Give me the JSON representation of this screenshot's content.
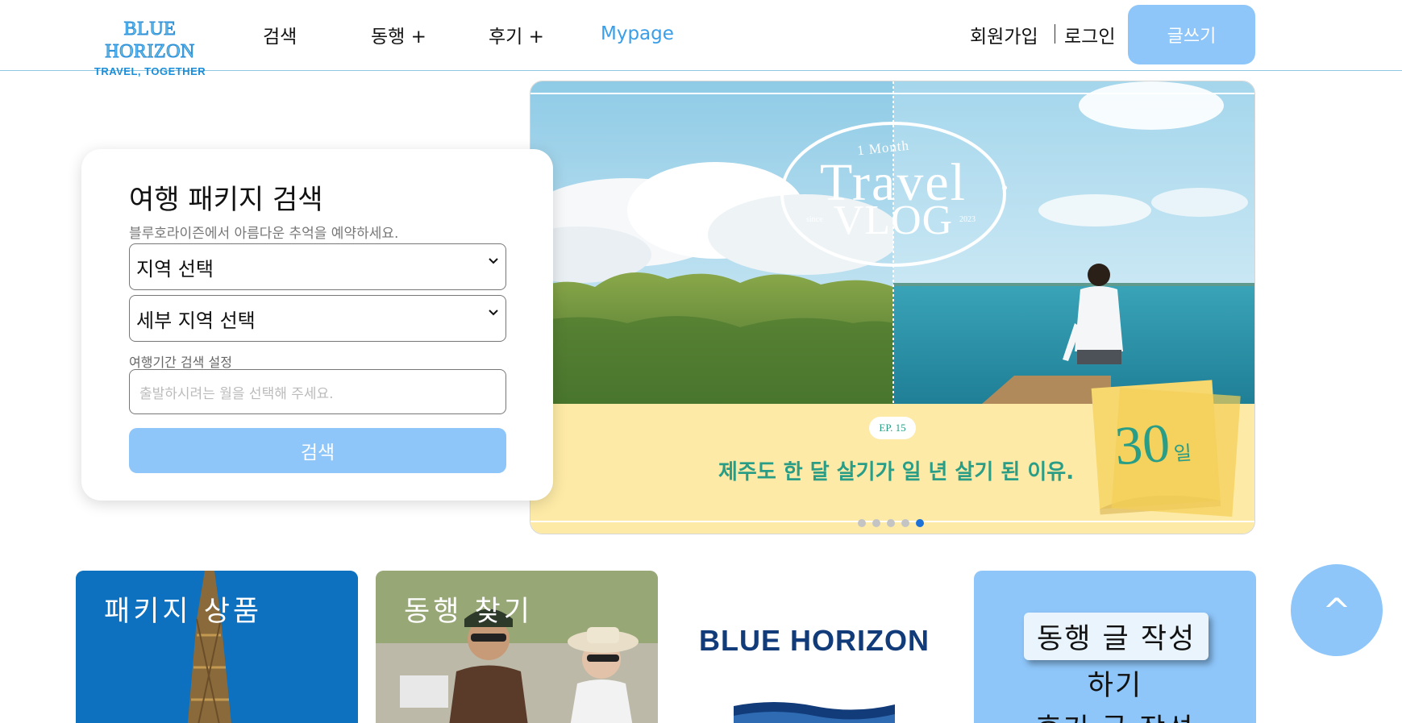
{
  "header": {
    "logo_main": "BLUE HORIZON",
    "logo_sub": "TRAVEL, TOGETHER",
    "nav": [
      {
        "label": "검색"
      },
      {
        "label": "동행 +"
      },
      {
        "label": "후기 +"
      },
      {
        "label": "Mypage"
      }
    ],
    "signup": "회원가입",
    "login": "로그인",
    "write_button": "글쓰기"
  },
  "search": {
    "title": "여행 패키지 검색",
    "subtitle": "블루호라이즌에서 아름다운 추억을 예약하세요.",
    "region_select": "지역 선택",
    "subregion_select": "세부 지역 선택",
    "period_label": "여행기간 검색 설정",
    "date_placeholder": "출발하시려는 월을 선택해 주세요.",
    "search_button": "검색"
  },
  "banner": {
    "small_title": "1 Month",
    "title_line1": "Travel",
    "title_line2": "VLOG",
    "since": "since",
    "year": "2023",
    "episode": "EP. 15",
    "caption": "제주도 한 달 살기가 일 년 살기 된 이유.",
    "days": "30",
    "days_unit": "일",
    "slide_count": 5,
    "active_slide": 5,
    "accent_color": "#2a9d86",
    "banner_bg": "#fdeaa6"
  },
  "tiles": {
    "package": "패키지 상품",
    "companion": "동행 찾기",
    "brand": "BLUE HORIZON",
    "write_companion": "동행 글 작성",
    "write_companion_2": "하기",
    "write_review": "후기 글 작성"
  },
  "scroll_top": "^",
  "colors": {
    "primary": "#8ec6fa",
    "link": "#3a9ee8",
    "brand_navy": "#123b7a"
  }
}
